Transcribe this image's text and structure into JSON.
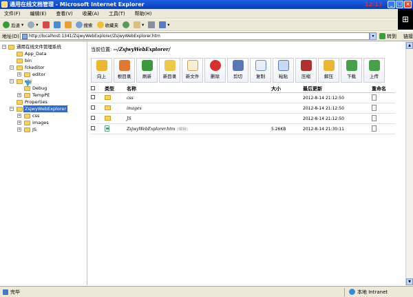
{
  "window": {
    "title": "通用在线文档管理 - Microsoft Internet Explorer",
    "clock": "12:17"
  },
  "menu": [
    "文件(F)",
    "编辑(E)",
    "查看(V)",
    "收藏(A)",
    "工具(T)",
    "帮助(H)"
  ],
  "toolbar": {
    "back": "后退",
    "search": "搜索",
    "favorites": "收藏夹"
  },
  "address": {
    "label": "地址(D)",
    "url": "http://localhost:1341/ZsjwyWebExplorer/ZsjwyWebExplorer.htm",
    "go": "转到",
    "links": "链接"
  },
  "tree": {
    "root": "通用在线文件管理系统",
    "items": [
      "App_Data",
      "bin",
      "fckeditor",
      "editor",
      "obj",
      "Debug",
      "TempPE",
      "Properties",
      "ZsjwyWebExplorer",
      "css",
      "images",
      "JS"
    ]
  },
  "breadcrumb": {
    "label": "当前位置:",
    "path": "--/ZsjwyWebExplorer/"
  },
  "actions": [
    "向上",
    "根目录",
    "刷新",
    "新目录",
    "新文件",
    "删除",
    "剪切",
    "复制",
    "粘贴",
    "压缩",
    "解压",
    "下载",
    "上传"
  ],
  "table": {
    "headers": {
      "type": "类型",
      "name": "名称",
      "size": "大小",
      "modified": "最后更新",
      "rename": "重命名"
    },
    "rows": [
      {
        "name": "css",
        "size": "",
        "modified": "2012-8-14 21:12:50",
        "kind": "folder"
      },
      {
        "name": "images",
        "size": "",
        "modified": "2012-8-14 21:12:50",
        "kind": "folder"
      },
      {
        "name": "JS",
        "size": "",
        "modified": "2012-8-14 21:12:50",
        "kind": "folder"
      },
      {
        "name": "ZsjwyWebExplorer.htm",
        "edit": "[编辑]",
        "size": "5.26KB",
        "modified": "2012-8-14 21:30:11",
        "kind": "file"
      }
    ]
  },
  "status": {
    "left": "完毕",
    "zone": "本地 Intranet"
  },
  "colors": {
    "titlebar": "#0b3fb6",
    "chrome": "#ece9d8",
    "selection": "#316ac5",
    "folder": "#f7d35c"
  }
}
